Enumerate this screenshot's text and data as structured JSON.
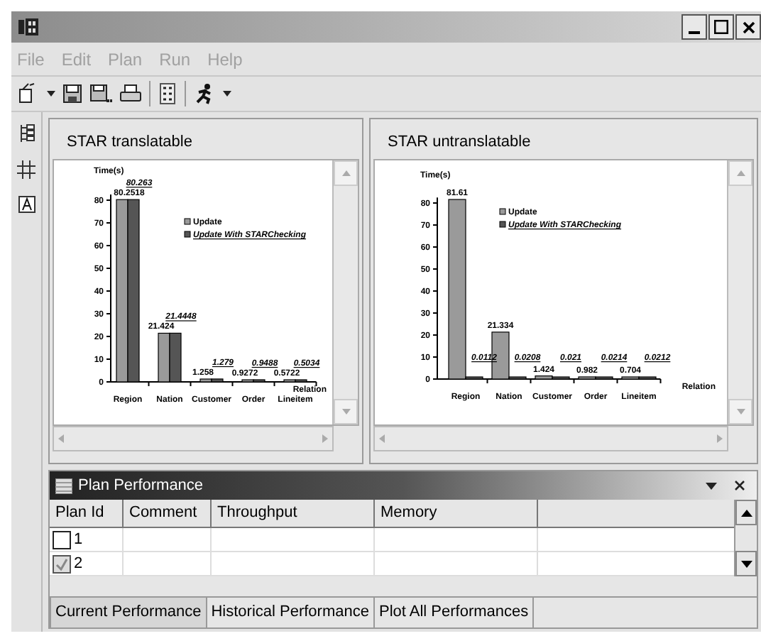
{
  "menu": [
    {
      "label": "File",
      "disabled": true
    },
    {
      "label": "Edit",
      "disabled": true
    },
    {
      "label": "Plan",
      "disabled": true
    },
    {
      "label": "Run",
      "disabled": true
    },
    {
      "label": "Help",
      "disabled": true
    }
  ],
  "charts": [
    {
      "title": "STAR translatable",
      "chart_data": {
        "type": "bar",
        "ylabel": "Time(s)",
        "xlabel": "Relation",
        "categories": [
          "Region",
          "Nation",
          "Customer",
          "Order",
          "Lineitem"
        ],
        "series": [
          {
            "name": "Update",
            "color": "#9a9a9a",
            "values": [
              80.2518,
              21.424,
              1.258,
              0.9272,
              0.5722
            ]
          },
          {
            "name": "Update With STARChecking",
            "color": "#555555",
            "values": [
              80.263,
              21.4448,
              1.279,
              0.9488,
              0.5034
            ]
          }
        ],
        "yticks": [
          0,
          10,
          20,
          30,
          40,
          50,
          60,
          70,
          80
        ],
        "ylim": [
          0,
          82.5
        ],
        "legend": true,
        "data_labels": true
      }
    },
    {
      "title": "STAR untranslatable",
      "chart_data": {
        "type": "bar",
        "ylabel": "Time(s)",
        "xlabel": "Relation",
        "categories": [
          "Region",
          "Nation",
          "Customer",
          "Order",
          "Lineitem"
        ],
        "series": [
          {
            "name": "Update",
            "color": "#9a9a9a",
            "values": [
              81.61,
              21.334,
              1.424,
              0.982,
              0.704
            ]
          },
          {
            "name": "Update With STARChecking",
            "color": "#555555",
            "values": [
              0.0112,
              0.0208,
              0.021,
              0.0214,
              0.0212
            ]
          }
        ],
        "yticks": [
          0,
          10,
          20,
          30,
          40,
          50,
          60,
          70,
          80
        ],
        "ylim": [
          0,
          82.5
        ],
        "legend": true,
        "data_labels": true
      }
    }
  ],
  "panel": {
    "title": "Plan Performance",
    "columns": [
      "Plan Id",
      "Comment",
      "Throughput",
      "Memory"
    ],
    "rows": [
      {
        "id": "1",
        "checked": false
      },
      {
        "id": "2",
        "checked": true
      }
    ],
    "tabs": [
      {
        "label": "Current Performance",
        "selected": true
      },
      {
        "label": "Historical Performance",
        "selected": false
      },
      {
        "label": "Plot All Performances",
        "selected": false
      }
    ]
  }
}
